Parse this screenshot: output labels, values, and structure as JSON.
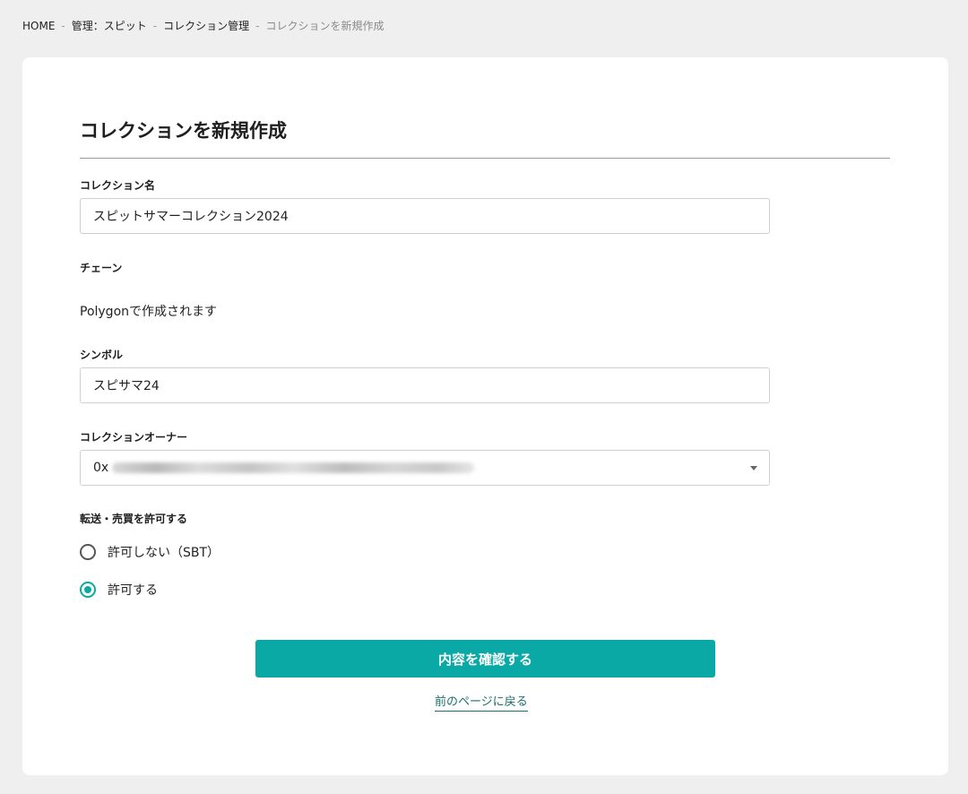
{
  "breadcrumb": {
    "items": [
      "HOME",
      "管理：スピット",
      "コレクション管理"
    ],
    "current": "コレクションを新規作成"
  },
  "page": {
    "title": "コレクションを新規作成"
  },
  "form": {
    "collection_name": {
      "label": "コレクション名",
      "value": "スピットサマーコレクション2024"
    },
    "chain": {
      "label": "チェーン",
      "text": "Polygonで作成されます"
    },
    "symbol": {
      "label": "シンボル",
      "value": "スピサマ24"
    },
    "owner": {
      "label": "コレクションオーナー",
      "value_prefix": "0x"
    },
    "transfer": {
      "label": "転送・売買を許可する",
      "options": [
        {
          "label": "許可しない（SBT）",
          "selected": false
        },
        {
          "label": "許可する",
          "selected": true
        }
      ]
    }
  },
  "actions": {
    "confirm_label": "内容を確認する",
    "back_label": "前のページに戻る"
  },
  "colors": {
    "accent": "#0aa9a6",
    "link": "#1b6f6d",
    "background": "#efefef"
  },
  "icons": {
    "radio": "radio-icon",
    "dropdown": "chevron-down-icon"
  }
}
